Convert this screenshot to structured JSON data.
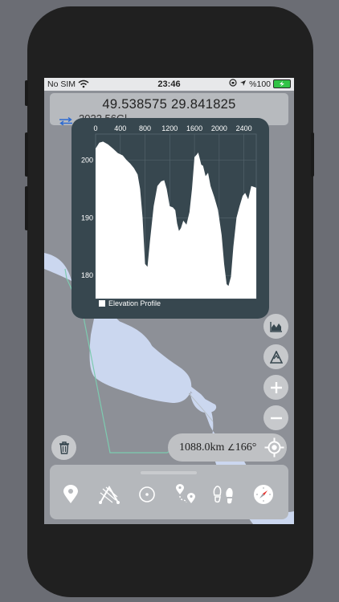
{
  "status_bar": {
    "carrier": "No SIM",
    "time": "23:46",
    "battery": "%100"
  },
  "coordinates": {
    "latlon": "49.538575 29.841825",
    "secondary": "2022.56Gl..."
  },
  "elevation_chart": {
    "legend": "Elevation Profile"
  },
  "chart_data": {
    "type": "area",
    "x_ticks": [
      "0",
      "400",
      "800",
      "1200",
      "1600",
      "2000",
      "2400"
    ],
    "y_ticks": [
      "200",
      "190",
      "180"
    ],
    "xlim": [
      0,
      2600
    ],
    "ylim": [
      176,
      204.5
    ],
    "grid": true,
    "x": [
      0,
      60,
      120,
      200,
      280,
      360,
      440,
      500,
      560,
      620,
      680,
      720,
      760,
      800,
      840,
      880,
      940,
      1000,
      1060,
      1110,
      1150,
      1200,
      1250,
      1290,
      1320,
      1350,
      1380,
      1420,
      1470,
      1520,
      1560,
      1600,
      1640,
      1660,
      1680,
      1710,
      1740,
      1780,
      1820,
      1860,
      1920,
      1980,
      2040,
      2080,
      2120,
      2150,
      2190,
      2230,
      2280,
      2330,
      2380,
      2420,
      2470,
      2520,
      2600
    ],
    "y": [
      202,
      203,
      203.2,
      202.7,
      202,
      201.2,
      200.8,
      200,
      199.4,
      198.6,
      197.5,
      195,
      190,
      182,
      181.5,
      186,
      192,
      195.5,
      196.3,
      196.5,
      195,
      192,
      191.8,
      191.3,
      189,
      187.7,
      188.2,
      189.5,
      188.8,
      191,
      195,
      200.5,
      201,
      201.3,
      200.5,
      199.2,
      199,
      197.2,
      197.8,
      195.5,
      193.6,
      191.4,
      187,
      182,
      178.5,
      178.2,
      179.8,
      185,
      190,
      192,
      193.8,
      194.3,
      193.2,
      195.5,
      195.2
    ]
  },
  "controls": {
    "distance": "1088.0km",
    "bearing": "166°"
  },
  "colors": {
    "chart_bg": "#37474f",
    "map_water": "#cbd7ef",
    "route": "#7dcbb0",
    "map_land": "#8d9097",
    "toolbar": "#b5b8bc"
  },
  "icons": {
    "layers": "area-chart-icon",
    "terrain": "mountain-icon",
    "zoom_in": "plus-icon",
    "zoom_out": "minus-icon",
    "locate": "crosshair-icon",
    "delete": "trash-icon",
    "tools": [
      "map-pin-icon",
      "route-measure-icon",
      "circle-target-icon",
      "waypoints-route-icon",
      "footprints-icon",
      "compass-icon"
    ]
  }
}
